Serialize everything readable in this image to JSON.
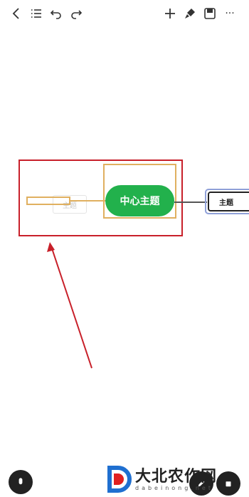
{
  "toolbar": {
    "icons": [
      "back-chevron-icon",
      "outline-list-icon",
      "undo-icon",
      "redo-icon",
      "add-icon",
      "style-brush-icon",
      "save-icon",
      "more-icon"
    ],
    "more_label": "···"
  },
  "mindmap": {
    "center_topic": "中心主题",
    "dragged_topic": "主题",
    "child_topic": "主题"
  },
  "colors": {
    "center_node": "#22b14c",
    "annotation": "#c8202a",
    "selection": "#e0b060",
    "child_highlight": "#8fa0d8"
  },
  "watermark": {
    "cn": "大北农作网",
    "en": "dabeinong.net"
  }
}
